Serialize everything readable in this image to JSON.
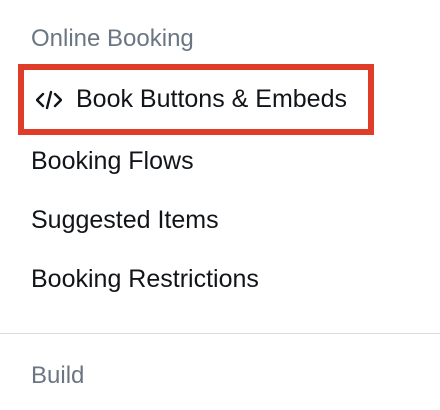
{
  "sections": {
    "online_booking": {
      "heading": "Online Booking",
      "items": [
        {
          "label": "Book Buttons & Embeds",
          "icon": "code-icon",
          "highlighted": true
        },
        {
          "label": "Booking Flows"
        },
        {
          "label": "Suggested Items"
        },
        {
          "label": "Booking Restrictions"
        }
      ]
    },
    "build": {
      "heading": "Build"
    }
  },
  "colors": {
    "heading": "#6b7683",
    "item_text": "#111418",
    "highlight_border": "#e03c2a",
    "divider": "#d9dde2"
  }
}
